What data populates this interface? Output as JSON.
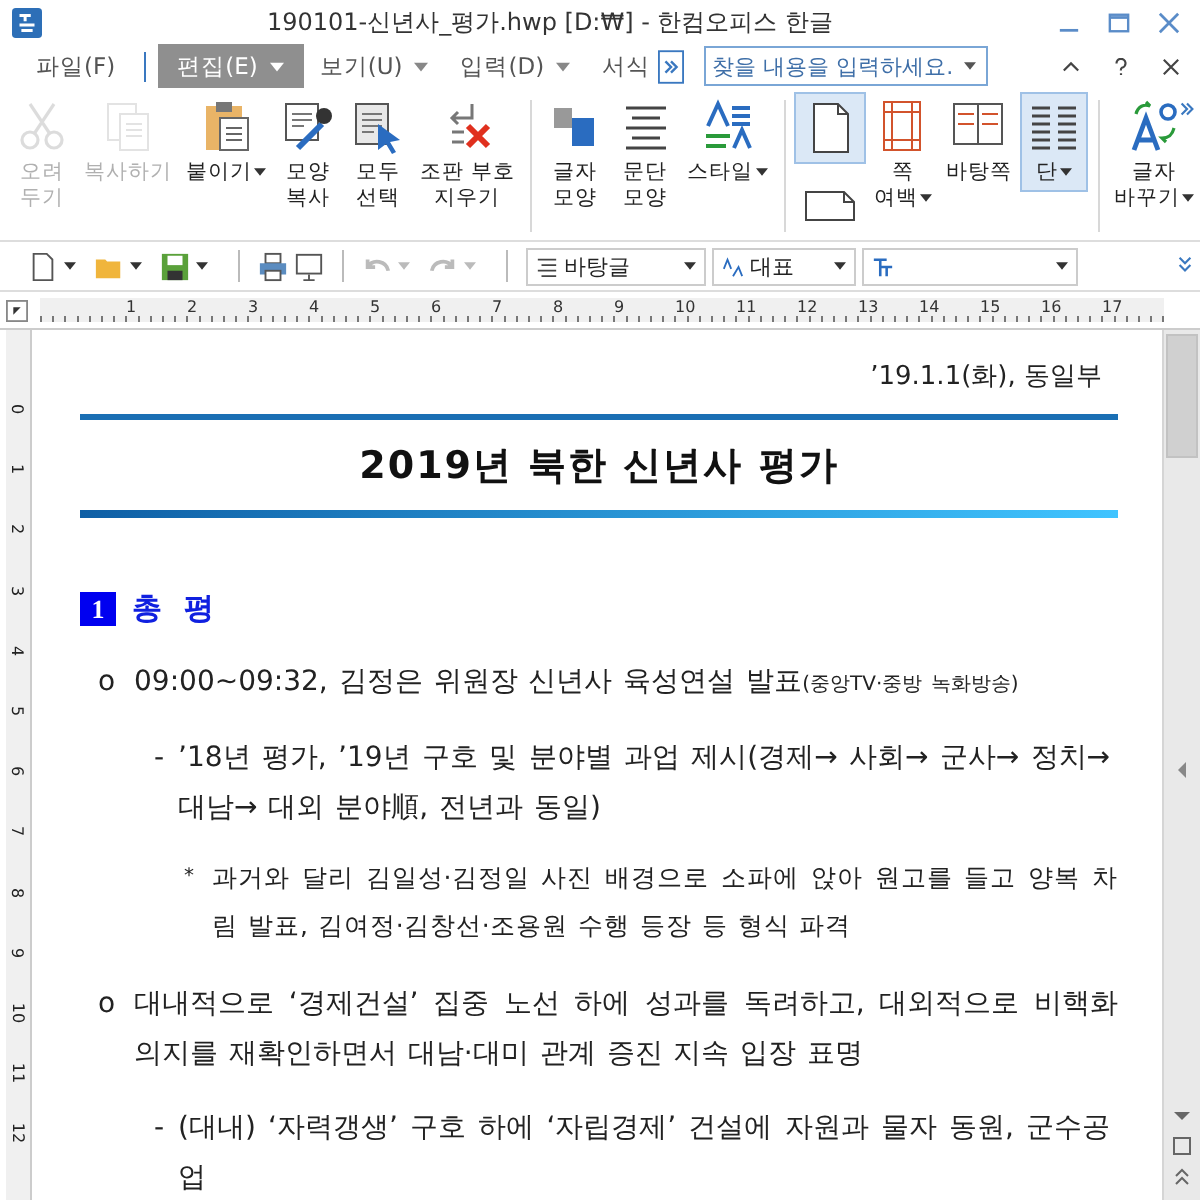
{
  "window": {
    "title": "190101-신년사_평가.hwp [D:₩] - 한컴오피스 한글"
  },
  "menu": [
    {
      "label": "파일(F)",
      "selected": false,
      "dropdown": false
    },
    {
      "label": "편집(E)",
      "selected": true,
      "dropdown": true
    },
    {
      "label": "보기(U)",
      "selected": false,
      "dropdown": true
    },
    {
      "label": "입력(D)",
      "selected": false,
      "dropdown": true
    },
    {
      "label": "서식",
      "selected": false,
      "dropdown": false
    }
  ],
  "search": {
    "placeholder": "찾을 내용을 입력하세요."
  },
  "ribbon": [
    {
      "columns": [
        [
          {
            "kind": "scissors",
            "label": "오려\n두기",
            "disabled": true,
            "selected": false,
            "dropdown": false
          }
        ],
        [
          {
            "kind": "copy",
            "label": "복사하기",
            "disabled": true,
            "selected": false,
            "dropdown": false
          }
        ],
        [
          {
            "kind": "paste",
            "label": "붙이기",
            "disabled": false,
            "selected": false,
            "dropdown": true
          }
        ],
        [
          {
            "kind": "eyedropper",
            "label": "모양\n복사",
            "disabled": false,
            "selected": false,
            "dropdown": false
          }
        ],
        [
          {
            "kind": "select",
            "label": "모두\n선택",
            "disabled": false,
            "selected": false,
            "dropdown": false
          }
        ],
        [
          {
            "kind": "erase",
            "label": "조판 부호\n지우기",
            "disabled": false,
            "selected": false,
            "dropdown": false
          }
        ]
      ]
    },
    {
      "columns": [
        [
          {
            "kind": "char",
            "label": "글자\n모양",
            "disabled": false,
            "selected": false,
            "dropdown": false
          }
        ],
        [
          {
            "kind": "para",
            "label": "문단\n모양",
            "disabled": false,
            "selected": false,
            "dropdown": false
          }
        ],
        [
          {
            "kind": "style",
            "label": "스타일",
            "disabled": false,
            "selected": false,
            "dropdown": true
          }
        ]
      ]
    },
    {
      "columns": [
        [
          {
            "kind": "portrait",
            "disabled": false,
            "selected": true,
            "dropdown": false
          },
          {
            "kind": "landscape",
            "disabled": false,
            "selected": false,
            "dropdown": false
          }
        ],
        [
          {
            "kind": "margin",
            "label": "쪽\n여백",
            "disabled": false,
            "selected": false,
            "dropdown": true
          }
        ],
        [
          {
            "kind": "master",
            "label": "바탕쪽",
            "disabled": false,
            "selected": false,
            "dropdown": false
          }
        ],
        [
          {
            "kind": "columns",
            "label": "단",
            "disabled": false,
            "selected": true,
            "dropdown": true
          }
        ]
      ]
    },
    {
      "columns": [
        [
          {
            "kind": "replace",
            "label": "글자\n바꾸기",
            "disabled": false,
            "selected": false,
            "dropdown": true
          }
        ]
      ]
    }
  ],
  "toolbar": {
    "style": "바탕글",
    "language": "대표"
  },
  "ruler": {
    "marks": [
      "1",
      "2",
      "3",
      "4",
      "5",
      "6",
      "7",
      "8",
      "9",
      "10",
      "11",
      "12",
      "13",
      "14",
      "15",
      "16",
      "17"
    ]
  },
  "vertical_ruler": {
    "marks": [
      "0",
      "1",
      "2",
      "3",
      "4",
      "5",
      "6",
      "7",
      "8",
      "9",
      "10",
      "11",
      "12"
    ]
  },
  "document": {
    "date": "’19.1.1(화), 동일부",
    "title": "2019년 북한 신년사 평가",
    "section": {
      "number": "1",
      "title": "총 평"
    },
    "paragraphs": [
      {
        "kind": "circle",
        "marker": "o",
        "text": "09:00~09:32, 김정은 위원장 신년사 육성연설 발표",
        "note": "(중앙TV·중방 녹화방송)"
      },
      {
        "kind": "dash",
        "marker": "-",
        "text": "’18년 평가, ’19년 구호 및 분야별 과업 제시(경제→ 사회→ 군사→ 정치→ 대남→ 대외 분야順, 전년과 동일)"
      },
      {
        "kind": "star",
        "marker": "*",
        "text": "과거와 달리 김일성·김정일 사진 배경으로 소파에 앉아 원고를 들고 양복 차림 발표, 김여정·김창선·조용원 수행 등장 등 형식 파격"
      },
      {
        "kind": "circle",
        "marker": "o",
        "text": "대내적으로 ‘경제건설’ 집중 노선 하에 성과를 독려하고, 대외적으로 비핵화 의지를 재확인하면서 대남·대미 관계 증진 지속 입장 표명"
      },
      {
        "kind": "dash",
        "marker": "-",
        "text": "(대내) ‘자력갱생’ 구호 하에 ‘자립경제’ 건설에 자원과 물자 동원, 군수공업"
      }
    ]
  }
}
